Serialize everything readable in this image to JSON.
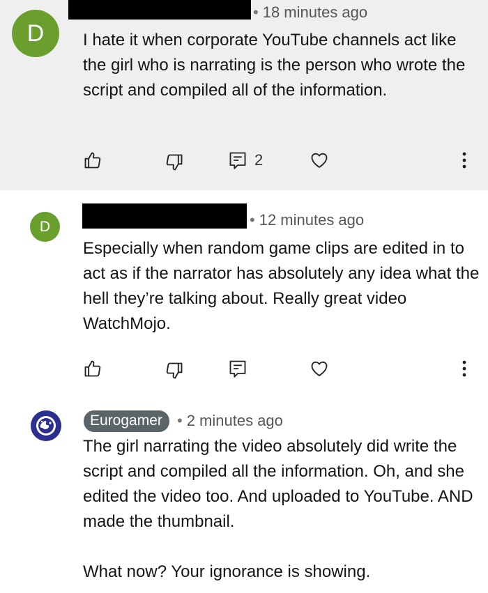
{
  "comments": [
    {
      "avatar_letter": "D",
      "timestamp": "18 minutes ago",
      "text": "I hate it when corporate YouTube channels act like the girl who is narrating is the person who wrote the script and compiled all of the information.",
      "reply_count": "2"
    },
    {
      "avatar_letter": "D",
      "timestamp": "12 minutes ago",
      "text": "Especially when random game clips are edited in to act as if the narrator has absolutely any idea what the hell they’re talking about. Really great video WatchMojo."
    },
    {
      "channel_name": "Eurogamer",
      "timestamp": "2 minutes ago",
      "text": "The girl narrating the video absolutely did write the script and compiled all the information. Oh, and she edited the video too. And uploaded to YouTube. AND made the thumbnail.\n\nWhat now? Your ignorance is showing."
    }
  ],
  "colors": {
    "avatar_green": "#6a9f2e",
    "highlight_bg": "#efefef",
    "channel_badge": "#5b6468",
    "eurogamer_blue": "#2b2f8f"
  },
  "icons": [
    "thumbs-up-icon",
    "thumbs-down-icon",
    "reply-icon",
    "heart-icon",
    "more-vert-icon",
    "eurogamer-logo"
  ]
}
